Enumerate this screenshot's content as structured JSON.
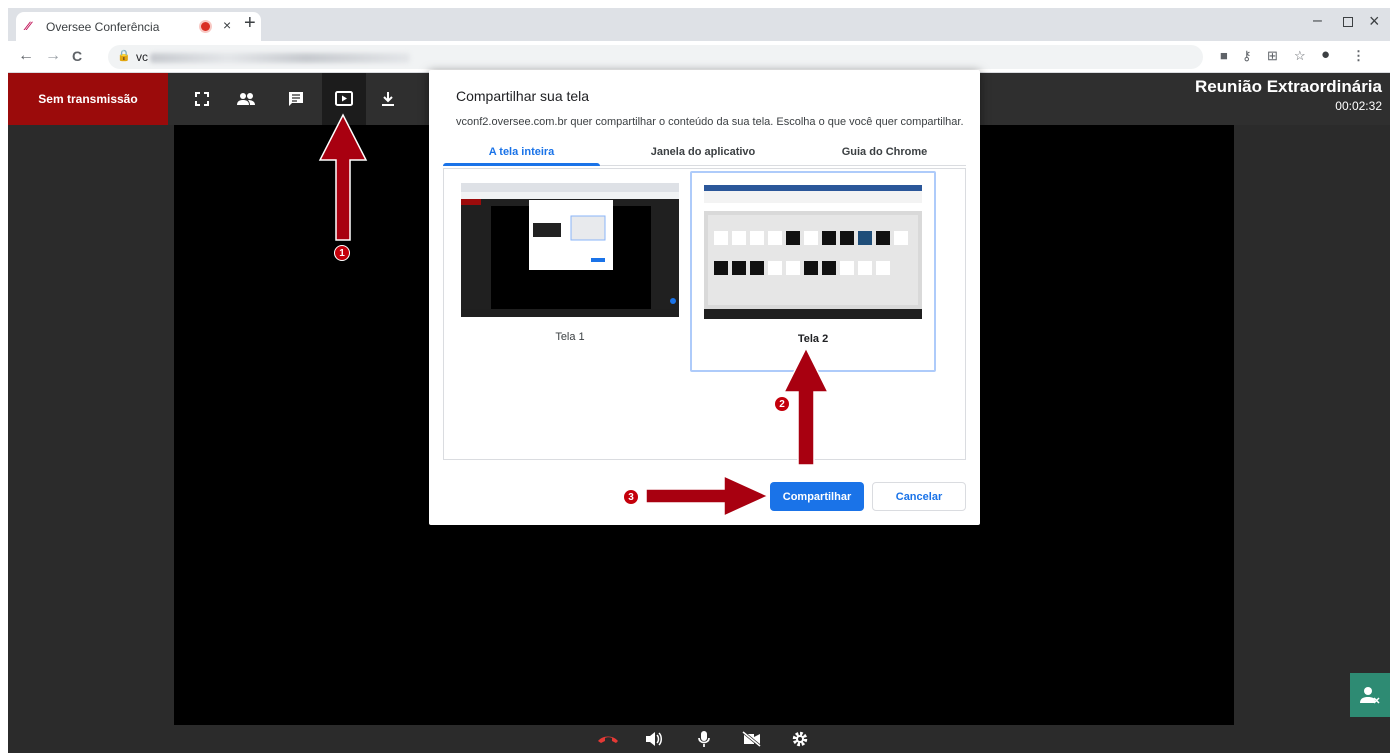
{
  "browser": {
    "tab_title": "Oversee Conferência",
    "tab_close": "×",
    "new_tab": "+",
    "win_min": "–",
    "win_close": "×",
    "back": "←",
    "forward": "→",
    "reload": "C",
    "url_visible": "vc"
  },
  "app": {
    "broadcast_status": "Sem transmissão",
    "meeting_title": "Reunião Extraordinária",
    "elapsed_time": "00:02:32",
    "toolbar_icons": [
      "fullscreen-icon",
      "participants-icon",
      "chat-icon",
      "screen-share-icon",
      "download-icon"
    ],
    "bottom_icons": [
      "hangup-icon",
      "volume-icon",
      "microphone-icon",
      "camera-off-icon",
      "settings-icon"
    ]
  },
  "dialog": {
    "title": "Compartilhar sua tela",
    "description": "vconf2.oversee.com.br quer compartilhar o conteúdo da sua tela. Escolha o que você quer compartilhar.",
    "tabs": [
      "A tela inteira",
      "Janela do aplicativo",
      "Guia do Chrome"
    ],
    "selected_tab": 0,
    "screens": [
      {
        "label": "Tela 1",
        "selected": false
      },
      {
        "label": "Tela 2",
        "selected": true
      }
    ],
    "share_label": "Compartilhar",
    "cancel_label": "Cancelar"
  },
  "annotations": {
    "step1": "1",
    "step2": "2",
    "step3": "3"
  },
  "colors": {
    "brand_red": "#9b0b0b",
    "arrow_red": "#a80010",
    "chrome_blue": "#1a73e8",
    "side_button": "#2e8b73"
  }
}
